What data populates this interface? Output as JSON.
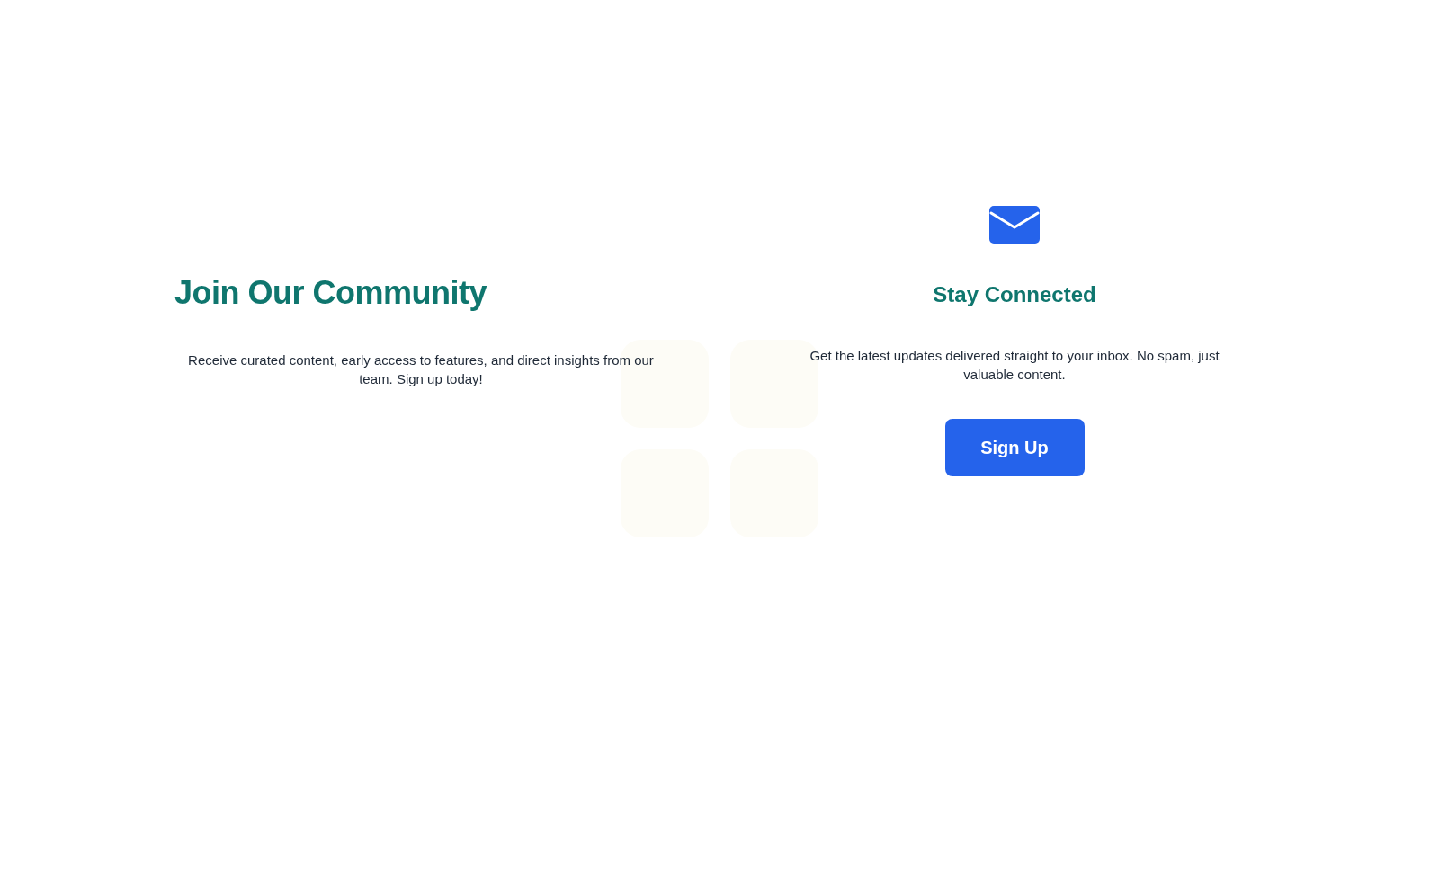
{
  "community": {
    "title": "Join Our Community",
    "description": "Receive curated content, early access to features, and direct insights from our team. Sign up today!"
  },
  "newsletter": {
    "title": "Stay Connected",
    "description": "Get the latest updates delivered straight to your inbox. No spam, just valuable content.",
    "button": "Sign Up"
  }
}
